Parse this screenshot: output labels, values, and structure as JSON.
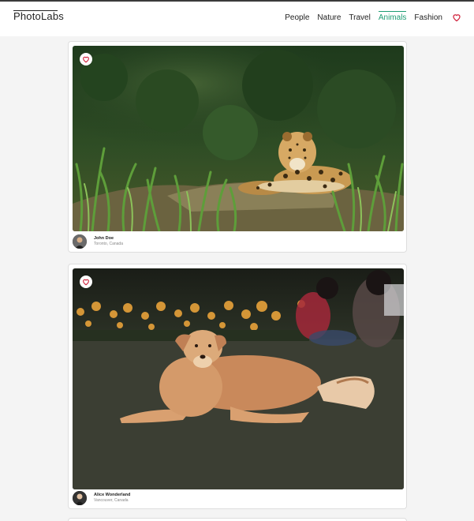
{
  "nav": {
    "logo": "PhotoLabs",
    "links": [
      "People",
      "Nature",
      "Travel",
      "Animals",
      "Fashion"
    ],
    "active": "Animals",
    "heart_icon": "heart-icon"
  },
  "colors": {
    "accent": "#1f9d74",
    "heart": "#d0203a"
  },
  "photos": [
    {
      "subject": "jaguar-photo",
      "author": {
        "name": "John Doe",
        "location": "Toronto, Canada"
      }
    },
    {
      "subject": "dog-photo",
      "author": {
        "name": "Alice Wonderland",
        "location": "Vancouver, Canada"
      }
    }
  ]
}
